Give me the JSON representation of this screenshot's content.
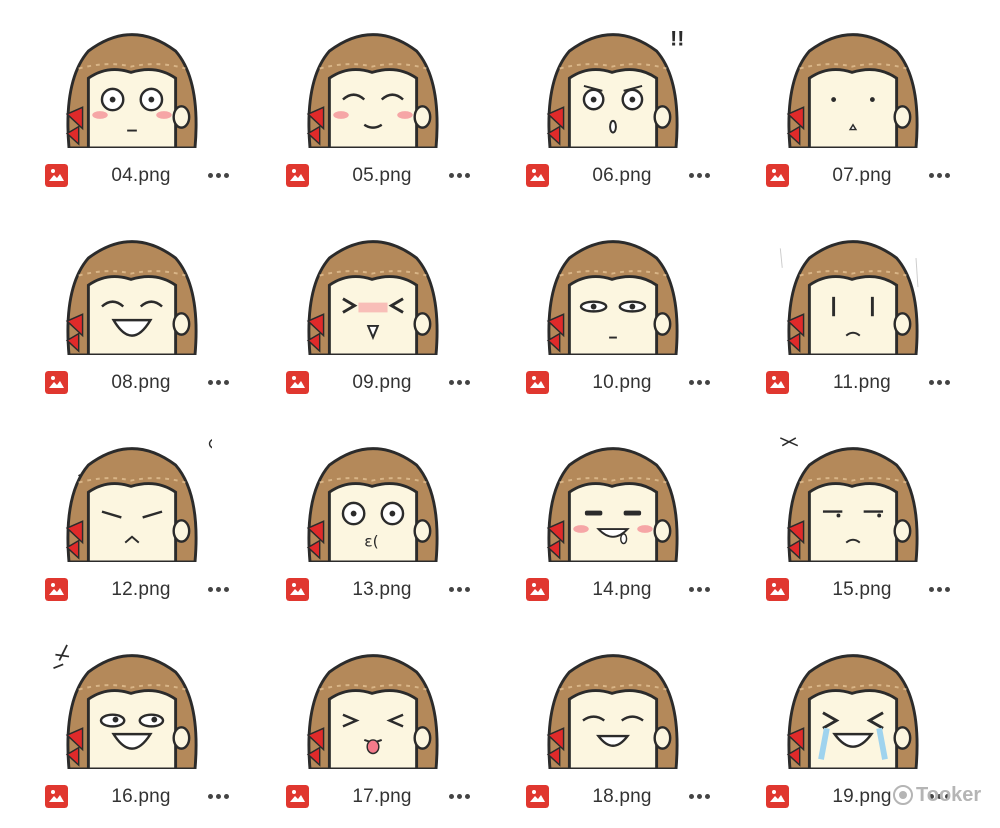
{
  "colors": {
    "file_icon_red": "#e0372f",
    "hair": "#b4895a",
    "skin": "#fcf6e0",
    "bow": "#e02a2a",
    "blush": "#f6a6a6"
  },
  "file_icon": "image-file-icon",
  "more_icon": "more-horizontal-icon",
  "files": [
    {
      "name": "04.png",
      "expression": "shocked"
    },
    {
      "name": "05.png",
      "expression": "happy-closed-eyes"
    },
    {
      "name": "06.png",
      "expression": "surprised-exclaim"
    },
    {
      "name": "07.png",
      "expression": "blank"
    },
    {
      "name": "08.png",
      "expression": "laughing"
    },
    {
      "name": "09.png",
      "expression": "squint-blush"
    },
    {
      "name": "10.png",
      "expression": "unamused"
    },
    {
      "name": "11.png",
      "expression": "worried"
    },
    {
      "name": "12.png",
      "expression": "angry"
    },
    {
      "name": "13.png",
      "expression": "dizzy"
    },
    {
      "name": "14.png",
      "expression": "drooling"
    },
    {
      "name": "15.png",
      "expression": "annoyed"
    },
    {
      "name": "16.png",
      "expression": "smug-laugh"
    },
    {
      "name": "17.png",
      "expression": "tongue-out"
    },
    {
      "name": "18.png",
      "expression": "nervous-smile"
    },
    {
      "name": "19.png",
      "expression": "crying"
    }
  ],
  "watermark": "Tooker"
}
